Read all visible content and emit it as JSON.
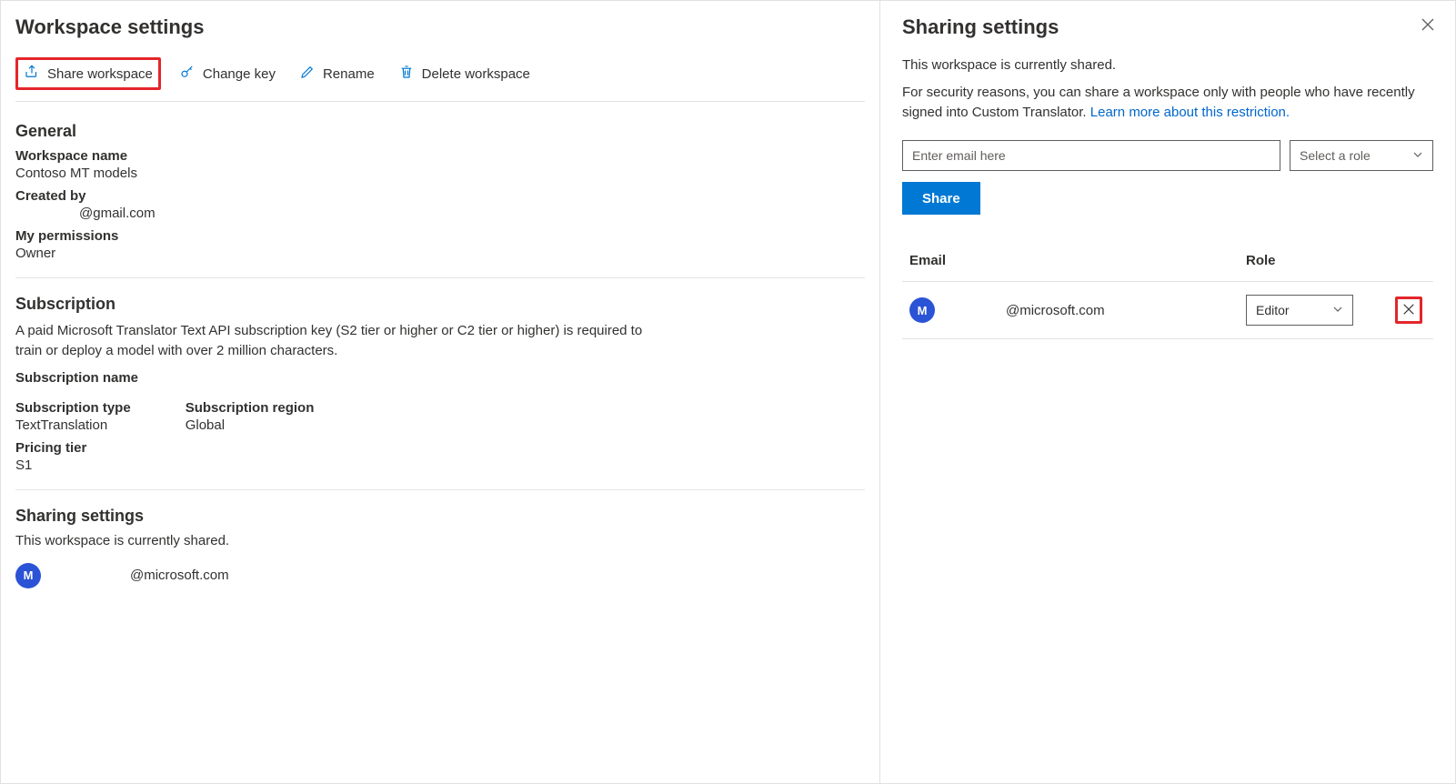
{
  "main": {
    "title": "Workspace settings",
    "toolbar": {
      "share": "Share workspace",
      "change_key": "Change key",
      "rename": "Rename",
      "delete": "Delete workspace"
    },
    "general": {
      "heading": "General",
      "name_label": "Workspace name",
      "name_value": "Contoso MT models",
      "created_label": "Created by",
      "created_value": "@gmail.com",
      "perm_label": "My permissions",
      "perm_value": "Owner"
    },
    "subscription": {
      "heading": "Subscription",
      "desc": "A paid Microsoft Translator Text API subscription key (S2 tier or higher or C2 tier or higher) is required to train or deploy a model with over 2 million characters.",
      "name_label": "Subscription name",
      "type_label": "Subscription type",
      "type_value": "TextTranslation",
      "region_label": "Subscription region",
      "region_value": "Global",
      "tier_label": "Pricing tier",
      "tier_value": "S1"
    },
    "sharing": {
      "heading": "Sharing settings",
      "status": "This workspace is currently shared.",
      "avatar_initial": "M",
      "shared_email": "@microsoft.com"
    }
  },
  "panel": {
    "title": "Sharing settings",
    "status": "This workspace is currently shared.",
    "security_text": "For security reasons, you can share a workspace only with people who have recently signed into Custom Translator. ",
    "learn_more": "Learn more about this restriction.",
    "email_placeholder": "Enter email here",
    "role_placeholder": "Select a role",
    "share_button": "Share",
    "table": {
      "email_header": "Email",
      "role_header": "Role",
      "row": {
        "avatar_initial": "M",
        "email": "@microsoft.com",
        "role": "Editor"
      }
    }
  }
}
